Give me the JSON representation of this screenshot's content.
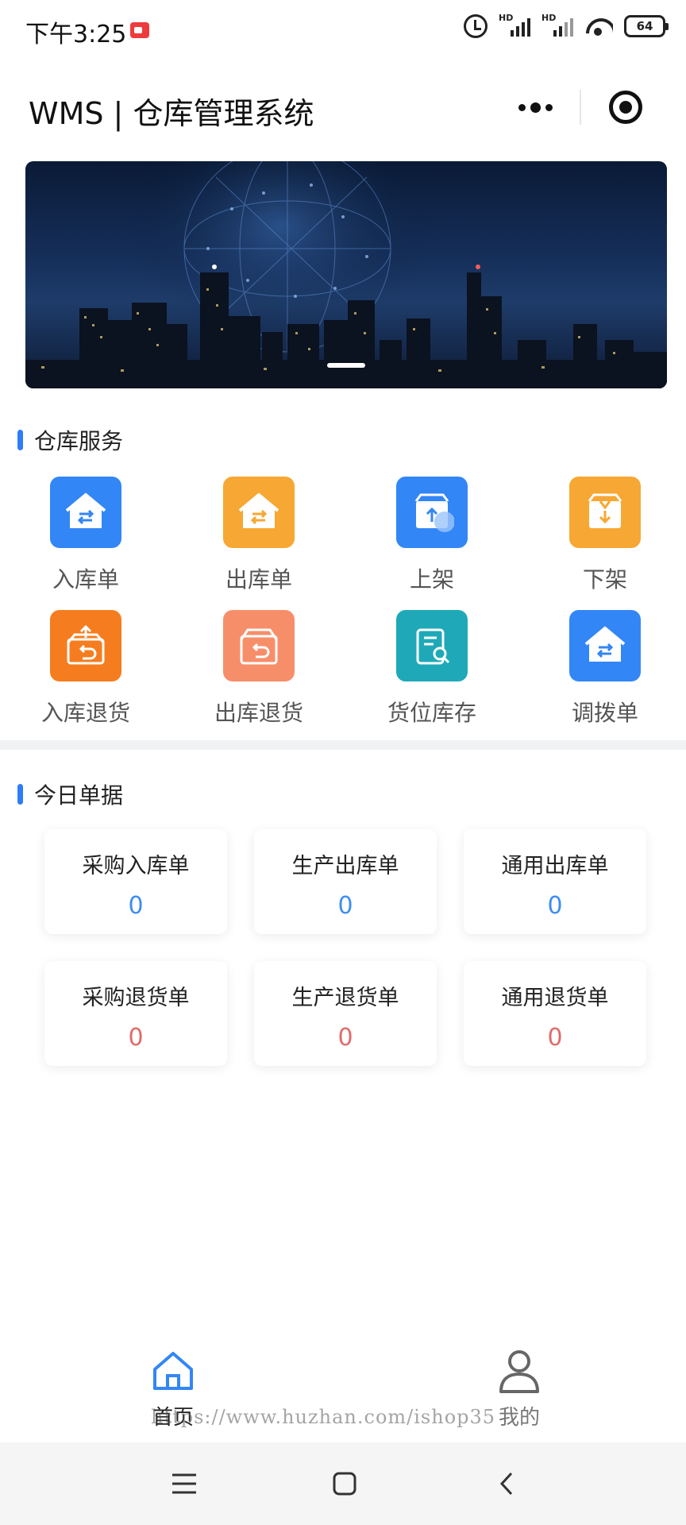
{
  "status_bar": {
    "time": "下午3:25",
    "battery": "64",
    "signal_label": "HD"
  },
  "nav": {
    "title": "WMS | 仓库管理系统"
  },
  "sections": {
    "services_title": "仓库服务",
    "today_title": "今日单据"
  },
  "services": [
    {
      "label": "入库单",
      "color": "#3386f5",
      "icon": "house-transfer-icon"
    },
    {
      "label": "出库单",
      "color": "#f7a733",
      "icon": "house-transfer-icon"
    },
    {
      "label": "上架",
      "color": "#3386f5",
      "icon": "box-up-icon"
    },
    {
      "label": "下架",
      "color": "#f7a733",
      "icon": "box-down-icon"
    },
    {
      "label": "入库退货",
      "color": "#f57d1f",
      "icon": "box-return-icon"
    },
    {
      "label": "出库退货",
      "color": "#f78e6a",
      "icon": "box-return-icon"
    },
    {
      "label": "货位库存",
      "color": "#1fa9b8",
      "icon": "clipboard-search-icon"
    },
    {
      "label": "调拨单",
      "color": "#3386f5",
      "icon": "house-transfer-icon"
    }
  ],
  "today_docs": [
    {
      "title": "采购入库单",
      "value": "0",
      "tone": "blue"
    },
    {
      "title": "生产出库单",
      "value": "0",
      "tone": "blue"
    },
    {
      "title": "通用出库单",
      "value": "0",
      "tone": "blue"
    },
    {
      "title": "采购退货单",
      "value": "0",
      "tone": "red"
    },
    {
      "title": "生产退货单",
      "value": "0",
      "tone": "red"
    },
    {
      "title": "通用退货单",
      "value": "0",
      "tone": "red"
    }
  ],
  "tabbar": {
    "home_label": "首页",
    "mine_label": "我的",
    "active_color": "#3386f5"
  },
  "watermark": "https://www.huzhan.com/ishop35"
}
